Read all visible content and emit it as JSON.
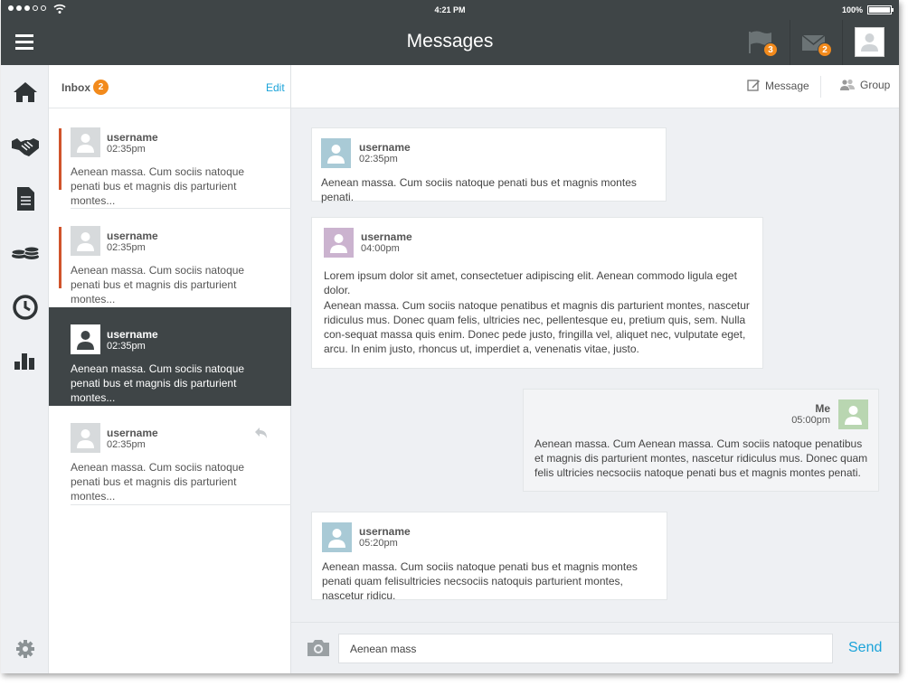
{
  "status": {
    "time": "4:21 PM",
    "battery": "100%"
  },
  "header": {
    "title": "Messages",
    "flag_badge": "3",
    "mail_badge": "2"
  },
  "sidebar": {
    "items": [
      {
        "name": "home-icon"
      },
      {
        "name": "handshake-icon"
      },
      {
        "name": "document-icon"
      },
      {
        "name": "coins-icon"
      },
      {
        "name": "clock-icon"
      },
      {
        "name": "bar-chart-icon"
      }
    ],
    "settings": {
      "name": "gear-icon"
    }
  },
  "inbox": {
    "label": "Inbox",
    "count": "2",
    "edit_label": "Edit",
    "conversations": [
      {
        "user": "username",
        "time": "02:35pm",
        "snippet": "Aenean massa. Cum sociis natoque penati bus et magnis dis parturient montes..."
      },
      {
        "user": "username",
        "time": "02:35pm",
        "snippet": "Aenean massa. Cum sociis natoque penati bus et magnis dis parturient montes..."
      },
      {
        "user": "username",
        "time": "02:35pm",
        "snippet": "Aenean massa. Cum sociis natoque penati bus et magnis dis parturient montes..."
      },
      {
        "user": "username",
        "time": "02:35pm",
        "snippet": "Aenean massa. Cum sociis natoque penati bus et magnis dis parturient montes..."
      }
    ]
  },
  "toolbar": {
    "message_label": "Message",
    "group_label": "Group"
  },
  "messages": [
    {
      "user": "username",
      "time": "02:35pm",
      "body": "Aenean massa. Cum sociis natoque penati bus et magnis montes penati."
    },
    {
      "user": "username",
      "time": "04:00pm",
      "body": "Lorem ipsum dolor sit amet, consectetuer adipiscing elit. Aenean commodo ligula eget dolor.",
      "body2": "Aenean massa. Cum sociis natoque penatibus et magnis dis parturient montes, nascetur ridiculus mus. Donec quam felis, ultricies nec, pellentesque eu, pretium quis, sem. Nulla con-sequat massa quis enim. Donec pede justo, fringilla vel, aliquet nec, vulputate eget, arcu. In enim justo, rhoncus ut, imperdiet a, venenatis vitae, justo."
    },
    {
      "user": "Me",
      "time": "05:00pm",
      "body": "Aenean massa. Cum Aenean massa. Cum sociis natoque penatibus et magnis dis parturient montes, nascetur ridiculus mus. Donec quam felis ultricies necsociis natoque penati bus et magnis montes penati."
    },
    {
      "user": "username",
      "time": "05:20pm",
      "body": "Aenean massa. Cum sociis natoque penati bus et magnis montes penati quam felisultricies necsociis natoquis parturient montes, nascetur ridicu."
    }
  ],
  "composer": {
    "value": "Aenean mass",
    "send_label": "Send"
  },
  "colors": {
    "header": "#3f4547",
    "accent": "#1aa3d9",
    "badge": "#f28a1c",
    "unread_bar": "#d0542b",
    "av_blue": "#a9cad6",
    "av_purple": "#cbb3cf",
    "av_green": "#b9d6b1"
  }
}
